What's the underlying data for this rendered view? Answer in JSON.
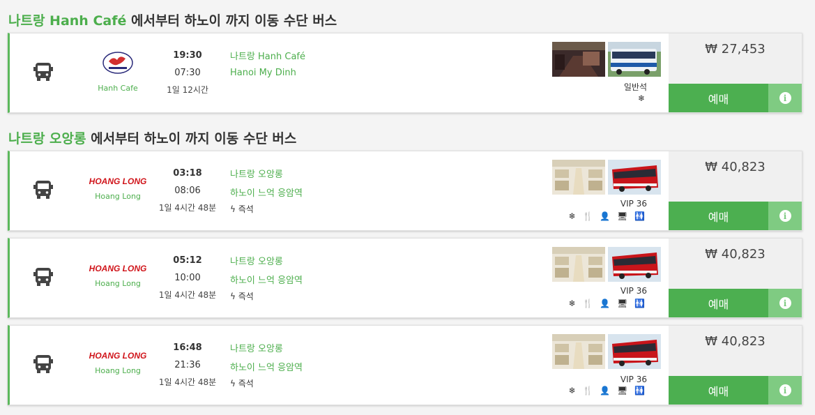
{
  "sections": [
    {
      "title_origin": "나트랑 Hanh Café",
      "title_rest": " 에서부터 하노이 까지 이동 수단 버스",
      "trips": [
        {
          "operator": "Hanh Cafe",
          "logo_text": "HANH CAFE",
          "departure": "19:30",
          "arrival": "07:30",
          "duration": "1일 12시간",
          "from": "나트랑 Hanh Café",
          "to": "Hanoi My Dinh",
          "instant": "",
          "seat_type": "일반석",
          "amenities": "❄",
          "price": "₩ 27,453",
          "book_label": "예매"
        }
      ]
    },
    {
      "title_origin": "나트랑 오앙롱",
      "title_rest": " 에서부터 하노이 까지 이동 수단 버스",
      "trips": [
        {
          "operator": "Hoang Long",
          "logo_text": "HOANG LONG",
          "departure": "03:18",
          "arrival": "08:06",
          "duration": "1일 4시간 48분",
          "from": "나트랑 오앙롱",
          "to": "하노이 느억 응암역",
          "instant": "즉석",
          "seat_type": "VIP 36",
          "amenities": "❄ 🍴 👤 🖥 🚻",
          "price": "₩ 40,823",
          "book_label": "예매"
        },
        {
          "operator": "Hoang Long",
          "logo_text": "HOANG LONG",
          "departure": "05:12",
          "arrival": "10:00",
          "duration": "1일 4시간 48분",
          "from": "나트랑 오앙롱",
          "to": "하노이 느억 응암역",
          "instant": "즉석",
          "seat_type": "VIP 36",
          "amenities": "❄ 🍴 👤 🖥 🚻",
          "price": "₩ 40,823",
          "book_label": "예매"
        },
        {
          "operator": "Hoang Long",
          "logo_text": "HOANG LONG",
          "departure": "16:48",
          "arrival": "21:36",
          "duration": "1일 4시간 48분",
          "from": "나트랑 오앙롱",
          "to": "하노이 느억 응암역",
          "instant": "즉석",
          "seat_type": "VIP 36",
          "amenities": "❄ 🍴 👤 🖥 🚻",
          "price": "₩ 40,823",
          "book_label": "예매"
        }
      ]
    }
  ],
  "colors": {
    "accent": "#4caf50",
    "accent_light": "#7fcb82",
    "green_text": "#4cae4c",
    "logo_red": "#d0141a"
  }
}
